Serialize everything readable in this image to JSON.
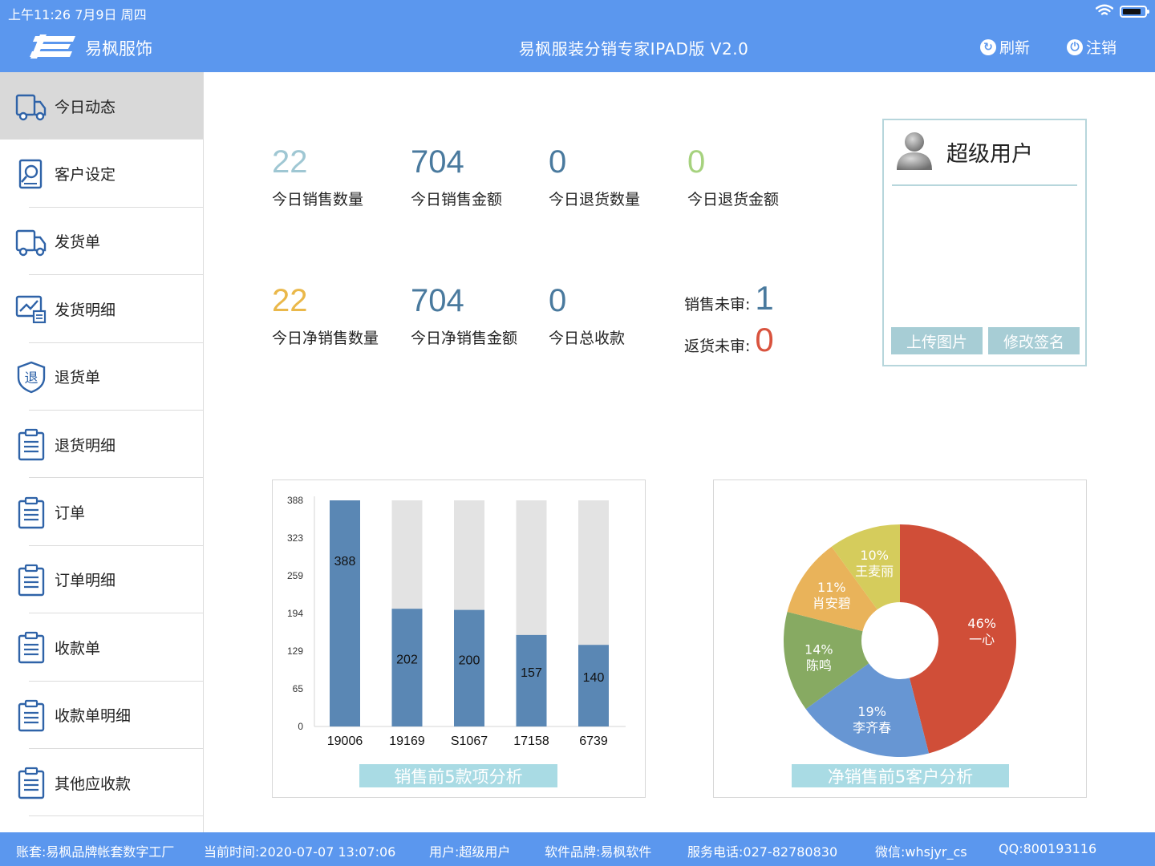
{
  "status_bar": {
    "time": "上午11:26   7月9日 周四",
    "battery_level": 0.85
  },
  "header": {
    "brand": "易枫服饰",
    "title": "易枫服装分销专家IPAD版 V2.0",
    "refresh_label": "刷新",
    "logout_label": "注销",
    "color": "#5b97ee"
  },
  "sidebar": {
    "items": [
      {
        "label": "今日动态",
        "icon": "truck-icon",
        "active": true
      },
      {
        "label": "客户设定",
        "icon": "customer-search-icon"
      },
      {
        "label": "发货单",
        "icon": "truck-icon"
      },
      {
        "label": "发货明细",
        "icon": "trend-chart-icon"
      },
      {
        "label": "退货单",
        "icon": "return-shield-icon"
      },
      {
        "label": "退货明细",
        "icon": "clipboard-icon"
      },
      {
        "label": "订单",
        "icon": "clipboard-icon"
      },
      {
        "label": "订单明细",
        "icon": "clipboard-icon"
      },
      {
        "label": "收款单",
        "icon": "clipboard-icon"
      },
      {
        "label": "收款单明细",
        "icon": "clipboard-icon"
      },
      {
        "label": "其他应收款",
        "icon": "clipboard-icon"
      }
    ],
    "return_icon_glyph": "退"
  },
  "stats": {
    "row1": [
      {
        "value": "22",
        "label": "今日销售数量",
        "color": "#9fc7d3"
      },
      {
        "value": "704",
        "label": "今日销售金额",
        "color": "#4a7a9e"
      },
      {
        "value": "0",
        "label": "今日退货数量",
        "color": "#4a7a9e"
      },
      {
        "value": "0",
        "label": "今日退货金额",
        "color": "#a6d27e"
      }
    ],
    "row2": [
      {
        "value": "22",
        "label": "今日净销售数量",
        "color": "#eab84a"
      },
      {
        "value": "704",
        "label": "今日净销售金额",
        "color": "#4a7a9e"
      },
      {
        "value": "0",
        "label": "今日总收款",
        "color": "#4a7a9e"
      }
    ],
    "pending_sales": {
      "label": "销售未审:",
      "value": "1",
      "color": "#4a7a9e"
    },
    "pending_returns": {
      "label": "返货未审:",
      "value": "0",
      "color": "#d9533e"
    }
  },
  "user_panel": {
    "name": "超级用户",
    "upload_label": "上传图片",
    "sign_label": "修改签名"
  },
  "chart_data": [
    {
      "type": "bar",
      "title": "销售前5款项分析",
      "categories": [
        "19006",
        "19169",
        "S1067",
        "17158",
        "6739"
      ],
      "values": [
        388,
        202,
        200,
        157,
        140
      ],
      "max": 388,
      "yticks": [
        0,
        65,
        129,
        194,
        259,
        323,
        388
      ],
      "ylim": [
        0,
        388
      ],
      "bar_color": "#5a87b4",
      "bg_color": "#e3e3e3"
    },
    {
      "type": "pie",
      "title": "净销售前5客户分析",
      "slices": [
        {
          "name": "一心",
          "percent": 46,
          "label": "46%",
          "color": "#d04e38"
        },
        {
          "name": "李齐春",
          "percent": 19,
          "label": "19%",
          "color": "#6796d3"
        },
        {
          "name": "陈鸣",
          "percent": 14,
          "label": "14%",
          "color": "#87aa62"
        },
        {
          "name": "肖安碧",
          "percent": 11,
          "label": "11%",
          "color": "#e9b35a"
        },
        {
          "name": "王麦丽",
          "percent": 10,
          "label": "10%",
          "color": "#d5cc5c"
        }
      ]
    }
  ],
  "footer": {
    "account": "账套:易枫品牌帐套数字工厂",
    "time": "当前时间:2020-07-07 13:07:06",
    "user": "用户:超级用户",
    "software": "软件品牌:易枫软件",
    "phone": "服务电话:027-82780830",
    "wechat": "微信:whsjyr_cs",
    "qq": "QQ:800193116"
  }
}
